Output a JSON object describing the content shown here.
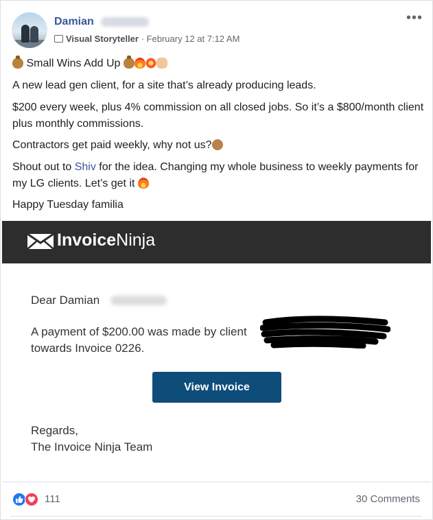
{
  "post": {
    "author_name": "Damian",
    "badge": "Visual Storyteller",
    "separator": "·",
    "timestamp": "February 12 at 7:12 AM",
    "more_label": "•••",
    "line0": "Small Wins Add Up",
    "line1": "A new lead gen client, for a site that’s already producing leads.",
    "line2": "$200 every week, plus 4% commission on all closed jobs. So it’s a $800/month client plus monthly commissions.",
    "line3": "Contractors get paid weekly, why not us?",
    "line4_pre": "Shout out to ",
    "line4_link": "Shiv",
    "line4_post": " for the idea. Changing my whole business to weekly payments for my LG clients. Let’s get it",
    "line5": "Happy Tuesday familia"
  },
  "invoice": {
    "brand_bold": "Invoice",
    "brand_light": "Ninja",
    "greeting": "Dear Damian",
    "payment_line": "A payment of $200.00 was made by client",
    "towards_line": "towards Invoice 0226.",
    "button_label": "View Invoice",
    "regards": "Regards,",
    "team": "The Invoice Ninja Team"
  },
  "footer": {
    "reaction_count": "111",
    "comments": "30 Comments"
  },
  "colors": {
    "link": "#385898",
    "author": "#365899",
    "invoice_button": "#0e4d7a",
    "invoice_header": "#2d2d2d",
    "like": "#2078f4",
    "love": "#f33e58"
  },
  "icons": [
    "more-options-icon",
    "badge-icon",
    "money-bag-icon",
    "fire-icon",
    "collision-icon",
    "raising-hands-icon",
    "shrug-icon",
    "envelope-logo-icon",
    "like-icon",
    "love-icon"
  ]
}
